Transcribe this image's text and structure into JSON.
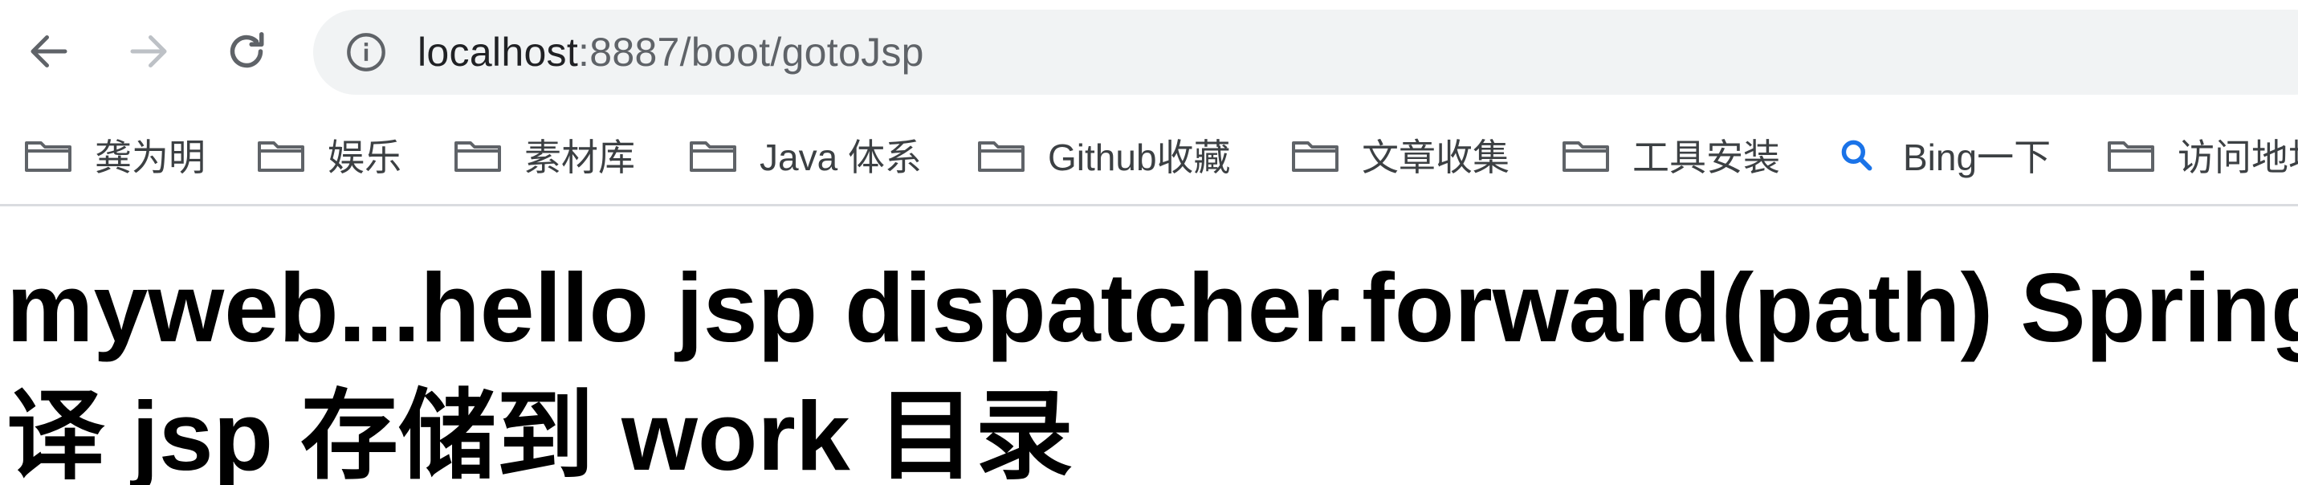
{
  "browser": {
    "url_host": "localhost",
    "url_rest": ":8887/boot/gotoJsp"
  },
  "bookmarks": [
    {
      "label": "龚为明",
      "icon": "folder-icon"
    },
    {
      "label": "娱乐",
      "icon": "folder-icon"
    },
    {
      "label": "素材库",
      "icon": "folder-icon"
    },
    {
      "label": "Java 体系",
      "icon": "folder-icon"
    },
    {
      "label": "Github收藏",
      "icon": "folder-icon"
    },
    {
      "label": "文章收集",
      "icon": "folder-icon"
    },
    {
      "label": "工具安装",
      "icon": "folder-icon"
    },
    {
      "label": "Bing一下",
      "icon": "search-icon"
    },
    {
      "label": "访问地址",
      "icon": "folder-icon"
    }
  ],
  "page": {
    "heading": "myweb...hello jsp dispatcher.forward(path) SpringBoot 编译 jsp 存储到 work 目录"
  },
  "colors": {
    "toolbar_icon": "#5f6368",
    "omnibox_bg": "#f1f3f4",
    "bookmark_folder": "#5f6368",
    "search_accent": "#1a73e8"
  }
}
